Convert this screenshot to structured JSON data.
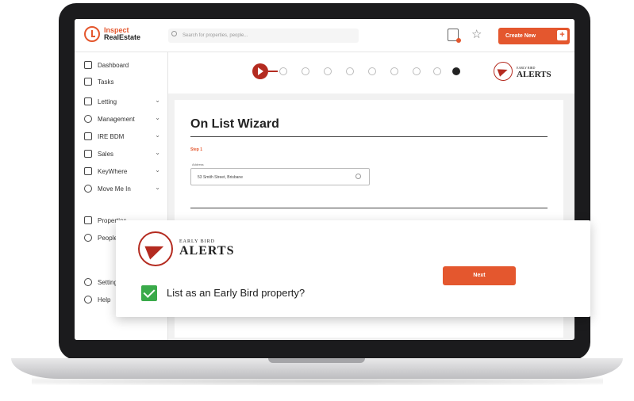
{
  "app": {
    "logo_line1": "Inspect",
    "logo_line2": "RealEstate"
  },
  "topbar": {
    "search_placeholder": "Search for properties, people...",
    "create_label": "Create New",
    "create_plus": "+"
  },
  "sidebar": {
    "items": [
      {
        "label": "Dashboard",
        "chevron": ""
      },
      {
        "label": "Tasks",
        "chevron": ""
      },
      {
        "label": "Letting",
        "chevron": "⌄"
      },
      {
        "label": "Management",
        "chevron": "⌄"
      },
      {
        "label": "IRE BDM",
        "chevron": "⌄"
      },
      {
        "label": "Sales",
        "chevron": "⌄"
      },
      {
        "label": "KeyWhere",
        "chevron": "⌄"
      },
      {
        "label": "Move Me In",
        "chevron": "⌄"
      },
      {
        "label": "Properties",
        "chevron": ""
      },
      {
        "label": "People",
        "chevron": ""
      },
      {
        "label": "Settings",
        "chevron": ""
      },
      {
        "label": "Help",
        "chevron": "⌄"
      }
    ]
  },
  "brand": {
    "eb_line1": "EARLY BIRD",
    "eb_line2": "ALERTS"
  },
  "wizard": {
    "title": "On List Wizard",
    "step": "Step 1",
    "address_label": "Address",
    "address_value": "53 Smith Street, Brisbane"
  },
  "popup": {
    "checkbox_label": "List as an Early Bird property?",
    "checked": true,
    "next_label": "Next"
  },
  "colors": {
    "accent": "#e4572e",
    "brand_red": "#b42b20",
    "check_green": "#3aaa4a"
  }
}
